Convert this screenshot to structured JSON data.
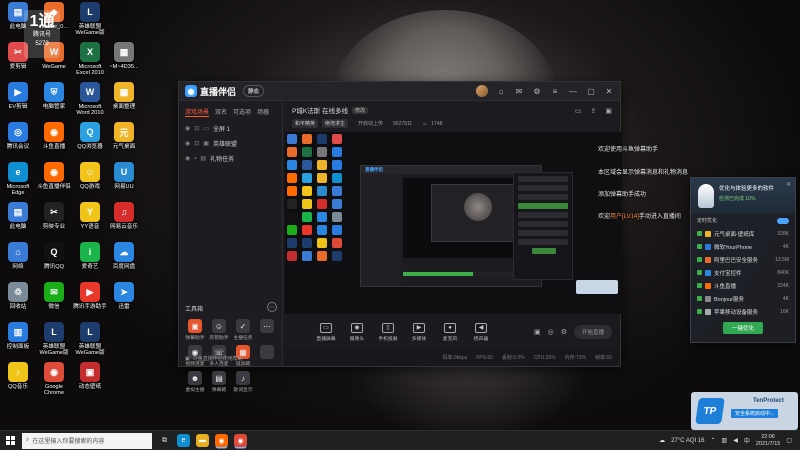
{
  "desktop": {
    "overlay": {
      "line1": "1通",
      "line2": "腾讯号",
      "line3": "5279"
    },
    "icons": [
      {
        "label": "此电脑",
        "color": "#3a7bd5",
        "glyph": "▤"
      },
      {
        "label": "master_0...",
        "color": "#e86b2a",
        "glyph": "◆"
      },
      {
        "label": "英雄联盟\nWeGame版",
        "color": "#1d3b6b",
        "glyph": "L"
      },
      {
        "label": "爱剪辑",
        "color": "#e04b4b",
        "glyph": "✂"
      },
      {
        "label": "WeGame",
        "color": "#e86b2a",
        "glyph": "W"
      },
      {
        "label": "Microsoft\nExcel 2010",
        "color": "#1e7145",
        "glyph": "X"
      },
      {
        "label": "~M~4D35...",
        "color": "#777777",
        "glyph": "▦"
      },
      {
        "label": "EV剪辑",
        "color": "#2a7be0",
        "glyph": "▶"
      },
      {
        "label": "电脑管家",
        "color": "#2a86e0",
        "glyph": "⛨"
      },
      {
        "label": "Microsoft\nWord 2010",
        "color": "#2b579a",
        "glyph": "W"
      },
      {
        "label": "桌面整理",
        "color": "#f0b429",
        "glyph": "▦"
      },
      {
        "label": "腾讯会议",
        "color": "#2a7be0",
        "glyph": "◎"
      },
      {
        "label": "斗鱼直播",
        "color": "#ff6a00",
        "glyph": "◉"
      },
      {
        "label": "QQ浏览器",
        "color": "#2aa0e0",
        "glyph": "Q"
      },
      {
        "label": "元气桌面",
        "color": "#f0b429",
        "glyph": "元"
      },
      {
        "label": "Microsoft\nEdge",
        "color": "#0f8fcf",
        "glyph": "e"
      },
      {
        "label": "斗鱼直播伴侣",
        "color": "#ff6a00",
        "glyph": "◉"
      },
      {
        "label": "QQ游戏",
        "color": "#f2c31b",
        "glyph": "☺"
      },
      {
        "label": "网易UU",
        "color": "#2a8ad0",
        "glyph": "U"
      },
      {
        "label": "此电脑",
        "color": "#3a7bd5",
        "glyph": "▤"
      },
      {
        "label": "剪映专业",
        "color": "#222222",
        "glyph": "✂"
      },
      {
        "label": "YY语音",
        "color": "#f0c419",
        "glyph": "Y"
      },
      {
        "label": "网易云音乐",
        "color": "#d62c2c",
        "glyph": "♫"
      },
      {
        "label": "网络",
        "color": "#3a7bd5",
        "glyph": "⌂"
      },
      {
        "label": "腾讯QQ",
        "color": "#111111",
        "glyph": "Q"
      },
      {
        "label": "爱奇艺",
        "color": "#1bb44a",
        "glyph": "i"
      },
      {
        "label": "百度网盘",
        "color": "#2a86e0",
        "glyph": "☁"
      },
      {
        "label": "回收站",
        "color": "#7a8a99",
        "glyph": "♲"
      },
      {
        "label": "微信",
        "color": "#1aad19",
        "glyph": "✉"
      },
      {
        "label": "腾讯手游助手",
        "color": "#e8382c",
        "glyph": "▶"
      },
      {
        "label": "迅雷",
        "color": "#2a86e0",
        "glyph": "➤"
      },
      {
        "label": "控制面板",
        "color": "#2a7be0",
        "glyph": "▥"
      },
      {
        "label": "英雄联盟\nWeGame版",
        "color": "#1d3b6b",
        "glyph": "L"
      },
      {
        "label": "英雄联盟\nWeGame版",
        "color": "#1d3b6b",
        "glyph": "L"
      },
      {
        "label": "QQ音乐",
        "color": "#f0c419",
        "glyph": "♪"
      },
      {
        "label": "Google\nChrome",
        "color": "#dd4b39",
        "glyph": "◉"
      },
      {
        "label": "动态壁纸",
        "color": "#c42d2d",
        "glyph": "▣"
      }
    ]
  },
  "app": {
    "title": "直播伴侣",
    "version": "静态",
    "tabs": [
      "游戏场景",
      "双名",
      "可选项",
      "场器"
    ],
    "scenes": [
      {
        "label": "全屏 1"
      },
      {
        "label": "英雄联盟"
      },
      {
        "label": "礼物任务"
      }
    ],
    "tools_title": "工具箱",
    "tools": [
      {
        "label": "弹幕助手",
        "color": "#e5562f",
        "glyph": "▣"
      },
      {
        "label": "房管助手",
        "color": "#3a3a40",
        "glyph": "☺"
      },
      {
        "label": "主播任务",
        "color": "#3a3a40",
        "glyph": "✓"
      },
      {
        "label": "",
        "color": "#3a3a40",
        "glyph": "⋯"
      },
      {
        "label": "视频连麦",
        "color": "#3a3a40",
        "glyph": "◉"
      },
      {
        "label": "多人连麦",
        "color": "#3a3a40",
        "glyph": "☏"
      },
      {
        "label": "道具箱",
        "color": "#e5562f",
        "glyph": "▦"
      },
      {
        "label": "",
        "color": "#3a3a40",
        "glyph": ""
      },
      {
        "label": "虚拟主播",
        "color": "#3a3a40",
        "glyph": "☻"
      },
      {
        "label": "弹幕箱",
        "color": "#3a3a40",
        "glyph": "▤"
      },
      {
        "label": "歌词显示",
        "color": "#3a3a40",
        "glyph": "♪"
      }
    ],
    "footer": "斗鱼直播伴侣使用帮助",
    "stream": {
      "title": "P城K法斯 在线多线",
      "edit_label": "修改",
      "tag1": "和平精英",
      "tag2": "绝地求生",
      "room_label": "开启动上传",
      "room_id": "9627911",
      "followers": "1748"
    },
    "controls": [
      {
        "label": "直播屏幕",
        "glyph": "▭"
      },
      {
        "label": "摄像头",
        "glyph": "◉"
      },
      {
        "label": "手机投屏",
        "glyph": "▯"
      },
      {
        "label": "多媒体",
        "glyph": "▶"
      },
      {
        "label": "麦克风",
        "glyph": "●"
      },
      {
        "label": "扬声器",
        "glyph": "◀"
      }
    ],
    "go_live": "开始直播",
    "status": [
      "码率:0kbps",
      "FPS:60",
      "丢帧:0.0%",
      "CPU:26%",
      "内存:73%",
      "帧率:60"
    ]
  },
  "danmaku": {
    "line1": "欢迎使用斗鱼弹幕助手",
    "line2": "本区域会显示弹幕消息和礼物消息",
    "line3": "添加弹幕助手成功",
    "line4_prefix": "欢迎",
    "line4_highlight": "用户[LV14]",
    "line4_suffix": "手动进入直播间"
  },
  "security_popup": {
    "title": "优化与体验更多的软件",
    "subtitle": "检测已完成 10%",
    "option": "定时优化",
    "items": [
      {
        "name": "元气桌面-壁纸库",
        "size": "328K",
        "color": "#f0b429"
      },
      {
        "name": "微软YourPhone",
        "size": "4K",
        "color": "#2a7be0"
      },
      {
        "name": "阿里巴巴安全服务",
        "size": "13.5M",
        "color": "#e86b2a"
      },
      {
        "name": "支付宝控件",
        "size": "840K",
        "color": "#2a86e0"
      },
      {
        "name": "斗鱼直播",
        "size": "224K",
        "color": "#ff6a00"
      },
      {
        "name": "Bonjour服务",
        "size": "4K",
        "color": "#888888"
      },
      {
        "name": "苹果移动设备服务",
        "size": "16K",
        "color": "#aaaaaa"
      }
    ],
    "button": "一键优化"
  },
  "toast": {
    "name": "TenProtect",
    "logo": "TP",
    "message": "安全系统启动中..."
  },
  "taskbar": {
    "search_placeholder": "在这里输入你要搜索的内容",
    "weather": "27°C AQI 16",
    "time": "22:06",
    "date": "2021/7/15"
  }
}
